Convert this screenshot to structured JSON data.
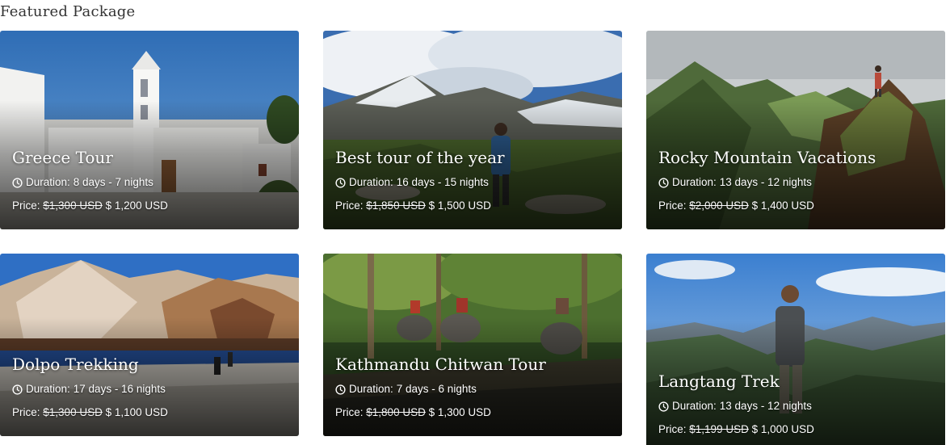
{
  "section": {
    "title": "Featured Package"
  },
  "labels": {
    "duration_prefix": "Duration:",
    "price_prefix": "Price:"
  },
  "packages": [
    {
      "title": "Greece Tour",
      "duration": "8 days - 7 nights",
      "old_price": "$1,300 USD",
      "price": "$ 1,200 USD",
      "icon": "clock-icon"
    },
    {
      "title": "Best tour of the year",
      "duration": "16 days - 15 nights",
      "old_price": "$1,850 USD",
      "price": "$ 1,500 USD",
      "icon": "clock-icon"
    },
    {
      "title": "Rocky Mountain Vacations",
      "duration": "13 days - 12 nights",
      "old_price": "$2,000 USD",
      "price": "$ 1,400 USD",
      "icon": "clock-icon"
    },
    {
      "title": "Dolpo Trekking",
      "duration": "17 days - 16 nights",
      "old_price": "$1,300 USD",
      "price": "$ 1,100 USD",
      "icon": "clock-icon"
    },
    {
      "title": "Kathmandu Chitwan Tour",
      "duration": "7 days - 6 nights",
      "old_price": "$1,800 USD",
      "price": "$ 1,300 USD",
      "icon": "clock-icon"
    },
    {
      "title": "Langtang Trek",
      "duration": "13 days - 12 nights",
      "old_price": "$1,199 USD",
      "price": "$ 1,000 USD",
      "icon": "clock-icon"
    }
  ]
}
